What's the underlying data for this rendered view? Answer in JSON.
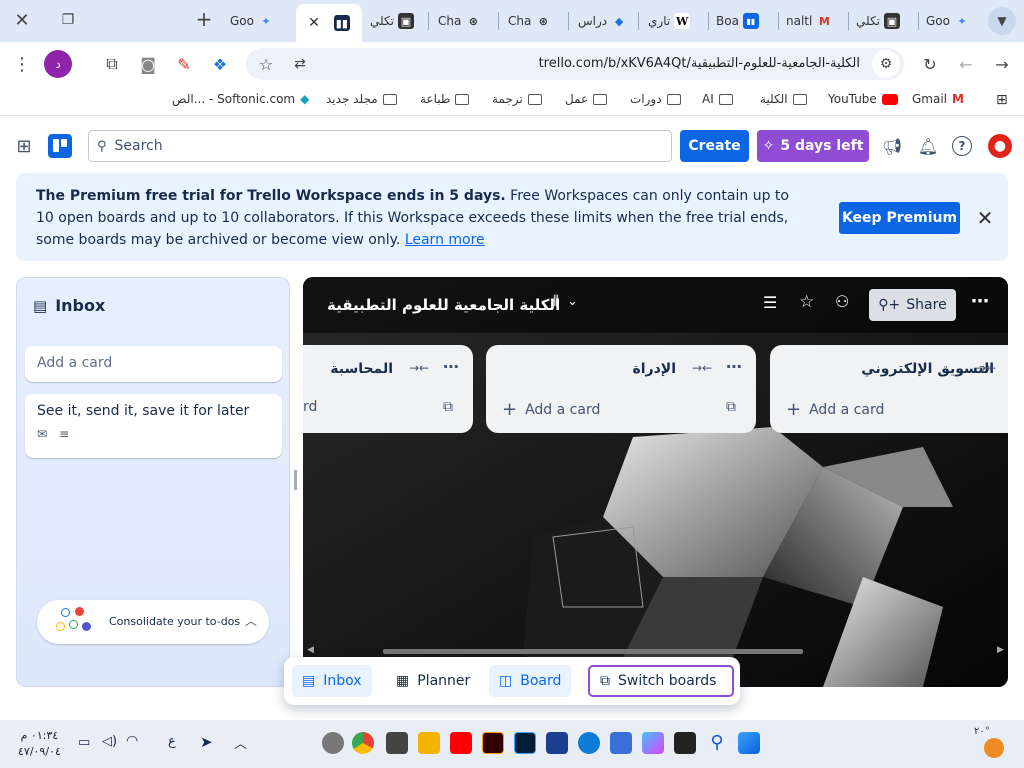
{
  "browser": {
    "tabs": [
      {
        "label": "Goo",
        "icon": "gemini-icon"
      },
      {
        "label": "تكلي",
        "icon": "profile-icon"
      },
      {
        "label": "Cha",
        "icon": "chatgpt-icon"
      },
      {
        "label": "Cha",
        "icon": "chatgpt-icon"
      },
      {
        "label": "دراس",
        "icon": "diamond-icon"
      },
      {
        "label": "تاري",
        "icon": "wikipedia-icon",
        "glyph": "W"
      },
      {
        "label": "Boa",
        "icon": "trello-icon"
      },
      {
        "label": "naltl",
        "icon": "gmail-icon",
        "glyph": "M"
      },
      {
        "label": "تكلي",
        "icon": "profile-icon"
      },
      {
        "label": "Goo",
        "icon": "gemini-icon"
      }
    ],
    "url": "trello.com/b/xKV6A4Qt/الكلية-الجامعية-للعلوم-التطبيقية",
    "profile_letter": "د",
    "bookmarks": [
      "Gmail",
      "YouTube",
      "الكلية",
      "AI",
      "دورات",
      "عمل",
      "ترجمة",
      "طباعة",
      "مجلد جديد",
      "الص... - Softonic.com"
    ]
  },
  "trello": {
    "search_placeholder": "Search",
    "create_label": "Create",
    "trial_label": "5 days left",
    "banner": {
      "bold": "The Premium free trial for Trello Workspace ends in 5 days.",
      "text": " Free Workspaces can only contain up to 10 open boards and up to 10 collaborators. If this Workspace exceeds these limits when the free trial ends, some boards may be archived or become view only. ",
      "link": "Learn more",
      "button": "Keep Premium"
    },
    "inbox": {
      "title": "Inbox",
      "add_card": "Add a card",
      "card_text": "See it, send it, save it for later",
      "consolidate": "Consolidate your to-dos"
    },
    "board": {
      "title": "الكلية الجامعية للعلوم التطبيقية",
      "share_label": "Share",
      "lists": [
        {
          "name": "التسويق الإلكتروني",
          "add": "Add a card"
        },
        {
          "name": "الإدراة",
          "add": "Add a card"
        },
        {
          "name": "المحاسبة",
          "add": "rd"
        }
      ]
    },
    "switcher": {
      "inbox": "Inbox",
      "planner": "Planner",
      "board": "Board",
      "switch": "Switch boards"
    }
  },
  "taskbar": {
    "time": "٠١:٣٤ م",
    "date": "٤٧/٠٩/٠٤",
    "lang": "ع",
    "temp": "٢٠°"
  },
  "colors": {
    "trello_blue": "#0c66e4",
    "trial_purple": "#8f4dd6",
    "banner_bg": "#e9f2ff"
  }
}
